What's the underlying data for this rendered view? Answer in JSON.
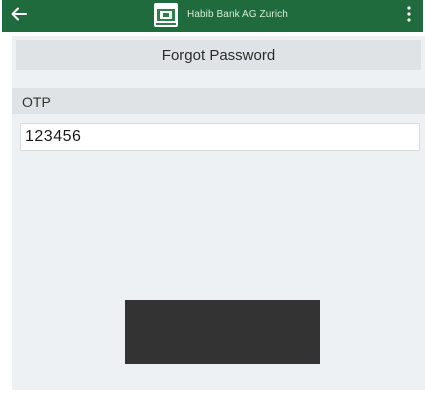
{
  "appbar": {
    "brand_name": "Habib Bank AG Zurich",
    "color": "#1f6b3e",
    "back_icon": "arrow-left-icon",
    "more_icon": "more-vertical-icon"
  },
  "page": {
    "title": "Forgot Password"
  },
  "otp_field": {
    "label": "OTP",
    "value": "123456"
  }
}
